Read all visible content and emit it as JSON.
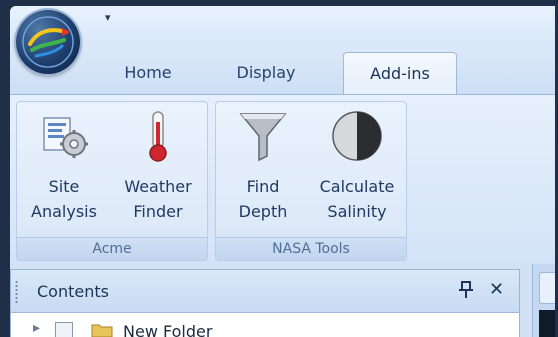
{
  "quick_access": {
    "chevron_glyph": "▾"
  },
  "tabs": [
    {
      "label": "Home",
      "selected": false
    },
    {
      "label": "Display",
      "selected": false
    },
    {
      "label": "Add-ins",
      "selected": true
    }
  ],
  "ribbon": {
    "groups": [
      {
        "label": "Acme",
        "buttons": [
          {
            "line1": "Site",
            "line2": "Analysis",
            "icon": "site-analysis-icon"
          },
          {
            "line1": "Weather",
            "line2": "Finder",
            "icon": "thermometer-icon"
          }
        ]
      },
      {
        "label": "NASA Tools",
        "buttons": [
          {
            "line1": "Find",
            "line2": "Depth",
            "icon": "funnel-icon"
          },
          {
            "line1": "Calculate",
            "line2": "Salinity",
            "icon": "half-circle-icon"
          }
        ]
      }
    ]
  },
  "contents_pane": {
    "title": "Contents",
    "pin_icon": "pin-icon",
    "close_glyph": "✕",
    "tree": [
      {
        "toggle_glyph": "▸",
        "label": "New Folder",
        "icon": "folder-icon"
      }
    ]
  }
}
